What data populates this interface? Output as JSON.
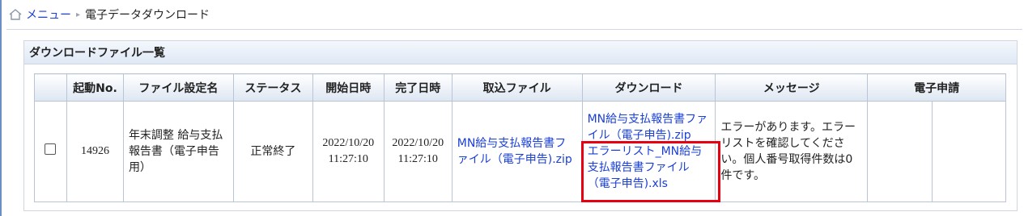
{
  "breadcrumb": {
    "menu_label": "メニュー",
    "separator": "▸",
    "current": "電子データダウンロード"
  },
  "panel": {
    "title": "ダウンロードファイル一覧"
  },
  "table": {
    "headers": {
      "run_no": "起動No.",
      "file_setting": "ファイル設定名",
      "status": "ステータス",
      "start": "開始日時",
      "end": "完了日時",
      "import_file": "取込ファイル",
      "download": "ダウンロード",
      "message": "メッセージ",
      "e_application": "電子申請"
    },
    "rows": [
      {
        "run_no": "14926",
        "file_setting": "年末調整 給与支払報告書（電子申告用）",
        "status": "正常終了",
        "start_date": "2022/10/20",
        "start_time": "11:27:10",
        "end_date": "2022/10/20",
        "end_time": "11:27:10",
        "import_file": "MN給与支払報告書ファイル（電子申告).zip",
        "download_1": "MN給与支払報告書ファイル（電子申告).zip",
        "download_2": "エラーリスト_MN給与支払報告書ファイル（電子申告).xls",
        "message": "エラーがあります。エラーリストを確認してください。個人番号取得件数は0件です。",
        "e_application": ""
      }
    ]
  },
  "colors": {
    "link": "#1a3fd6",
    "highlight": "#e60012",
    "header_bg": "#dde6f2"
  }
}
